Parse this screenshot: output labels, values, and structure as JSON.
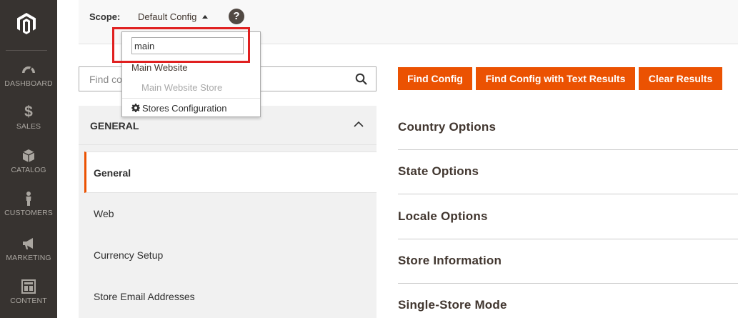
{
  "nav": {
    "items": [
      {
        "label": "DASHBOARD",
        "icon": "dashboard-icon"
      },
      {
        "label": "SALES",
        "icon": "dollar-icon"
      },
      {
        "label": "CATALOG",
        "icon": "box-icon"
      },
      {
        "label": "CUSTOMERS",
        "icon": "person-icon"
      },
      {
        "label": "MARKETING",
        "icon": "megaphone-icon"
      },
      {
        "label": "CONTENT",
        "icon": "layout-icon"
      }
    ]
  },
  "scope": {
    "label": "Scope:",
    "current": "Default Config",
    "help": "?"
  },
  "dropdown": {
    "search_value": "main",
    "website": "Main Website",
    "store": "Main Website Store",
    "config_link": "Stores Configuration"
  },
  "search": {
    "placeholder": "Find config by keyword"
  },
  "tabs": {
    "group_title": "GENERAL",
    "items": [
      "General",
      "Web",
      "Currency Setup",
      "Store Email Addresses"
    ]
  },
  "buttons": {
    "find": "Find Config",
    "find_text": "Find Config with Text Results",
    "clear": "Clear Results"
  },
  "sections": [
    "Country Options",
    "State Options",
    "Locale Options",
    "Store Information",
    "Single-Store Mode"
  ],
  "colors": {
    "accent": "#eb5202",
    "nav_bg": "#373330",
    "highlight": "#e02020"
  }
}
